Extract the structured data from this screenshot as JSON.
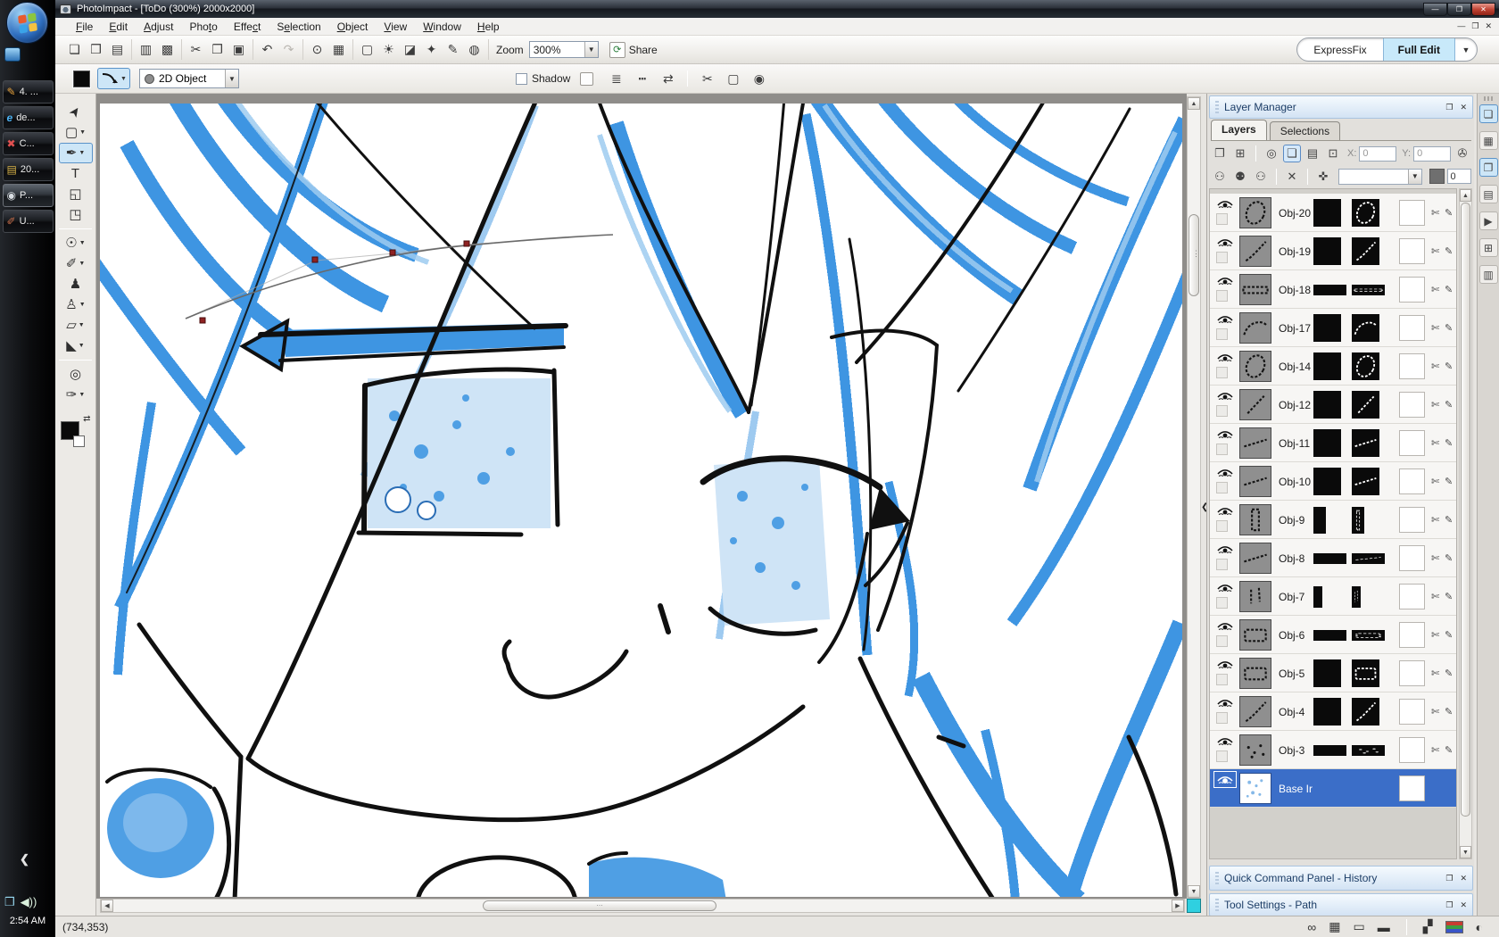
{
  "window": {
    "title": "PhotoImpact - [ToDo (300%) 2000x2000]"
  },
  "menu": {
    "items": [
      {
        "label": "File",
        "underline": 0
      },
      {
        "label": "Edit",
        "underline": 0
      },
      {
        "label": "Adjust",
        "underline": 0
      },
      {
        "label": "Photo",
        "underline": 3
      },
      {
        "label": "Effect",
        "underline": 4
      },
      {
        "label": "Selection",
        "underline": 1
      },
      {
        "label": "Object",
        "underline": 0
      },
      {
        "label": "View",
        "underline": 0
      },
      {
        "label": "Window",
        "underline": 0
      },
      {
        "label": "Help",
        "underline": 0
      }
    ]
  },
  "toolbar": {
    "zoom_label": "Zoom",
    "zoom_value": "300%",
    "share_label": "Share",
    "expressfix_label": "ExpressFix",
    "fulledit_label": "Full Edit",
    "groups": [
      [
        {
          "name": "new-icon",
          "glyph": "❏"
        },
        {
          "name": "open-icon",
          "glyph": "❒"
        },
        {
          "name": "save-icon",
          "glyph": "▤"
        }
      ],
      [
        {
          "name": "print-icon",
          "glyph": "▥"
        },
        {
          "name": "print-options-icon",
          "glyph": "▩"
        }
      ],
      [
        {
          "name": "cut-icon",
          "glyph": "✂"
        },
        {
          "name": "copy-icon",
          "glyph": "❐"
        },
        {
          "name": "paste-icon",
          "glyph": "▣"
        }
      ],
      [
        {
          "name": "undo-icon",
          "glyph": "↶"
        },
        {
          "name": "redo-icon",
          "glyph": "↷",
          "disabled": true
        }
      ],
      [
        {
          "name": "capture-icon",
          "glyph": "⊙"
        },
        {
          "name": "browse-icon",
          "glyph": "▦"
        }
      ],
      [
        {
          "name": "screen-icon",
          "glyph": "▢"
        },
        {
          "name": "brightness-icon",
          "glyph": "☀"
        },
        {
          "name": "levels-icon",
          "glyph": "◪"
        },
        {
          "name": "quickfix-icon",
          "glyph": "✦"
        },
        {
          "name": "pen-adjust-icon",
          "glyph": "✎"
        },
        {
          "name": "web-icon",
          "glyph": "◍"
        }
      ]
    ]
  },
  "attribute_bar": {
    "object_type": "2D Object",
    "shadow_label": "Shadow",
    "icons": [
      {
        "name": "line-style-icon",
        "glyph": "≣"
      },
      {
        "name": "dash-style-icon",
        "glyph": "┅"
      },
      {
        "name": "arrow-style-icon",
        "glyph": "⇄"
      },
      {
        "sep": true
      },
      {
        "name": "trim-path-icon",
        "glyph": "✂"
      },
      {
        "name": "capsule-icon",
        "glyph": "▢"
      },
      {
        "name": "snapshot-icon",
        "glyph": "◉"
      }
    ]
  },
  "toolbox": {
    "tools": [
      {
        "name": "pick-tool",
        "glyph": "➤"
      },
      {
        "name": "selection-tool",
        "glyph": "▢",
        "arrow": true
      },
      {
        "name": "path-tool",
        "glyph": "✒",
        "active": true,
        "arrow": true
      },
      {
        "name": "text-tool",
        "glyph": "T"
      },
      {
        "name": "crop-tool",
        "glyph": "◱"
      },
      {
        "name": "transform-tool",
        "glyph": "◳"
      },
      {
        "sep": true
      },
      {
        "name": "touchup-tool",
        "glyph": "☉",
        "arrow": true
      },
      {
        "name": "paint-tool",
        "glyph": "✐",
        "arrow": true
      },
      {
        "name": "clone-tool",
        "glyph": "♟"
      },
      {
        "name": "stamp-tool",
        "glyph": "♙",
        "arrow": true
      },
      {
        "name": "eraser-tool",
        "glyph": "▱",
        "arrow": true
      },
      {
        "name": "fill-tool",
        "glyph": "◣",
        "arrow": true
      },
      {
        "sep": true
      },
      {
        "name": "zoom-tool",
        "glyph": "◎"
      },
      {
        "name": "eyedropper-tool",
        "glyph": "✑",
        "arrow": true
      }
    ]
  },
  "taskbar": {
    "buttons": [
      {
        "name": "taskbar-button-4",
        "label": "4. ...",
        "glyph": "✎",
        "color": "#e8a33d"
      },
      {
        "name": "taskbar-button-de",
        "label": "de...",
        "glyph": "e",
        "color": "#4db2f2",
        "italic": true
      },
      {
        "name": "taskbar-button-c",
        "label": "C...",
        "glyph": "✖",
        "color": "#e05050"
      },
      {
        "name": "taskbar-button-20",
        "label": "20...",
        "glyph": "▤",
        "color": "#d9b44a"
      },
      {
        "name": "taskbar-button-p",
        "label": "P...",
        "glyph": "◉",
        "color": "#d8dde2",
        "active": true
      },
      {
        "name": "taskbar-button-u",
        "label": "U...",
        "glyph": "✐",
        "color": "#c96f4a"
      }
    ],
    "tray": [
      {
        "name": "network-tray-icon",
        "glyph": "❒",
        "color": "#9adcf5"
      },
      {
        "name": "volume-tray-icon",
        "glyph": "◀))",
        "color": "#d9efdc"
      }
    ],
    "clock": "2:54 AM"
  },
  "layer_manager": {
    "title": "Layer Manager",
    "tabs": [
      "Layers",
      "Selections"
    ],
    "x_label": "X:",
    "x_value": "0",
    "y_label": "Y:",
    "y_value": "0",
    "opacity_value": "0",
    "toolbar1": [
      {
        "name": "duplicate-icon",
        "glyph": "❐"
      },
      {
        "name": "to-table-icon",
        "glyph": "⊞"
      },
      {
        "sep": true
      },
      {
        "name": "preview-zoom-icon",
        "glyph": "◎"
      },
      {
        "name": "thumbnail-view-icon",
        "glyph": "❏",
        "selected": true
      },
      {
        "name": "properties-icon",
        "glyph": "▤"
      },
      {
        "name": "edit-window-icon",
        "glyph": "⊡"
      }
    ],
    "toolbar2": [
      {
        "name": "show-all-objects-icon",
        "glyph": "⚇"
      },
      {
        "name": "hide-objects-icon",
        "glyph": "⚉"
      },
      {
        "name": "show-marked-icon",
        "glyph": "⚇"
      },
      {
        "sep": true
      },
      {
        "name": "delete-object-icon",
        "glyph": "✕"
      },
      {
        "sep": true
      },
      {
        "name": "pin-icon",
        "glyph": "✜"
      }
    ],
    "link_icon_glyph": "✇",
    "row_icons": [
      {
        "name": "trim-icon",
        "glyph": "✄"
      },
      {
        "name": "edit-icon",
        "glyph": "✎"
      }
    ],
    "layers": [
      {
        "name": "Obj-20",
        "shape": "ellipse",
        "aspect": "square"
      },
      {
        "name": "Obj-19",
        "shape": "curve",
        "aspect": "square"
      },
      {
        "name": "Obj-18",
        "shape": "bar",
        "aspect": "wide"
      },
      {
        "name": "Obj-17",
        "shape": "arc",
        "aspect": "square"
      },
      {
        "name": "Obj-14",
        "shape": "ellipse",
        "aspect": "square"
      },
      {
        "name": "Obj-12",
        "shape": "diag",
        "aspect": "square"
      },
      {
        "name": "Obj-11",
        "shape": "diag2",
        "aspect": "square"
      },
      {
        "name": "Obj-10",
        "shape": "diag2",
        "aspect": "square"
      },
      {
        "name": "Obj-9",
        "shape": "vbar",
        "aspect": "tall"
      },
      {
        "name": "Obj-8",
        "shape": "diag2",
        "aspect": "wide"
      },
      {
        "name": "Obj-7",
        "shape": "marks",
        "aspect": "tiny"
      },
      {
        "name": "Obj-6",
        "shape": "blob",
        "aspect": "wide"
      },
      {
        "name": "Obj-5",
        "shape": "blob",
        "aspect": "square"
      },
      {
        "name": "Obj-4",
        "shape": "curve",
        "aspect": "square"
      },
      {
        "name": "Obj-3",
        "shape": "dots",
        "aspect": "wide"
      },
      {
        "name": "Base Ir",
        "shape": "speckle",
        "selected": true
      }
    ]
  },
  "panels": {
    "quick_command": "Quick Command Panel - History",
    "tool_settings": "Tool Settings - Path"
  },
  "right_strip": {
    "buttons": [
      {
        "name": "layer-manager-panel-button",
        "glyph": "❏",
        "active": true
      },
      {
        "name": "pattern-panel-button",
        "glyph": "▦"
      },
      {
        "name": "quick-command-panel-button",
        "glyph": "❐",
        "active": true
      },
      {
        "name": "document-panel-button",
        "glyph": "▤"
      },
      {
        "name": "navigator-panel-button",
        "glyph": "▶"
      },
      {
        "name": "grid-panel-button",
        "glyph": "⊞"
      },
      {
        "name": "options-panel-button",
        "glyph": "▥"
      }
    ]
  },
  "statusbar": {
    "coords": "(734,353)",
    "icons": [
      {
        "name": "mask-mode-icon",
        "glyph": "∞"
      },
      {
        "name": "grid-table-icon",
        "glyph": "▦"
      },
      {
        "name": "selection-frame-icon",
        "glyph": "▭"
      },
      {
        "name": "ruler-icon",
        "glyph": "▬"
      },
      {
        "sep": true
      },
      {
        "name": "histogram-icon",
        "glyph": "▞"
      },
      {
        "name": "rgb-channels-icon",
        "type": "rgb",
        "colors": [
          "#c83c32",
          "#3c9e42",
          "#3a55c8"
        ]
      },
      {
        "name": "preview-eye-icon",
        "glyph": "◐"
      }
    ]
  },
  "colors": {
    "selection_blue": "#3B6EC8",
    "sketch_blue": "#3E95E2",
    "full_edit_highlight": "#C8E9FA",
    "panel_header_blue": "#D3E3F4",
    "corner_cyan": "#2FD0E0"
  }
}
